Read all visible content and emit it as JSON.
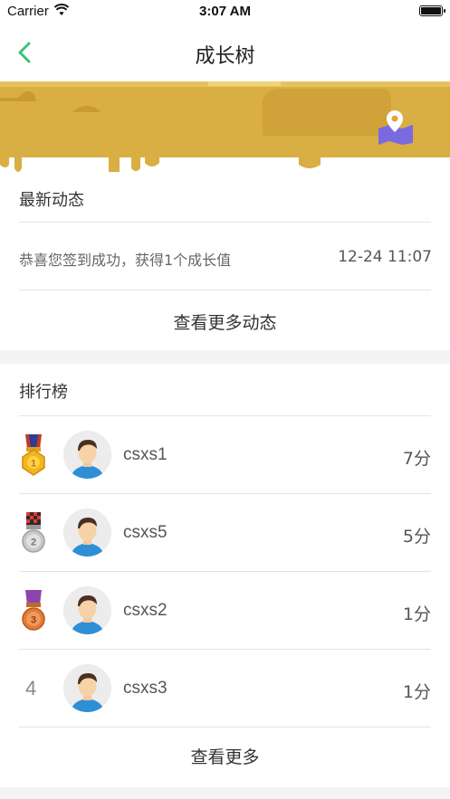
{
  "status_bar": {
    "carrier": "Carrier",
    "time": "3:07 AM"
  },
  "nav": {
    "title": "成长树",
    "back_icon": "chevron-left-icon",
    "accent_color": "#3cc07a"
  },
  "banner": {
    "color": "#d9ae42",
    "location_icon": "map-pin-icon"
  },
  "news": {
    "title": "最新动态",
    "items": [
      {
        "text": "恭喜您签到成功，获得1个成长值",
        "time": "12-24 11:07"
      }
    ],
    "more_label": "查看更多动态"
  },
  "ranking": {
    "title": "排行榜",
    "rows": [
      {
        "rank": "1",
        "medal": "gold-medal-icon",
        "name": "csxs1",
        "score": "7分"
      },
      {
        "rank": "2",
        "medal": "silver-medal-icon",
        "name": "csxs5",
        "score": "5分"
      },
      {
        "rank": "3",
        "medal": "bronze-medal-icon",
        "name": "csxs2",
        "score": "1分"
      },
      {
        "rank": "4",
        "medal": "",
        "name": "csxs3",
        "score": "1分"
      }
    ],
    "more_label": "查看更多"
  }
}
